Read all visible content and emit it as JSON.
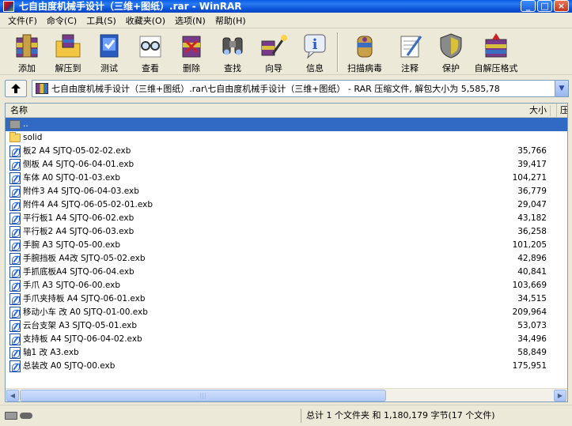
{
  "window": {
    "title": "七自由度机械手设计（三维+图纸）.rar - WinRAR"
  },
  "menu": [
    "文件(F)",
    "命令(C)",
    "工具(S)",
    "收藏夹(O)",
    "选项(N)",
    "帮助(H)"
  ],
  "toolbar": {
    "add": "添加",
    "extract": "解压到",
    "test": "测试",
    "view": "查看",
    "delete": "删除",
    "find": "查找",
    "wizard": "向导",
    "info": "信息",
    "virus": "扫描病毒",
    "comment": "注释",
    "protect": "保护",
    "sfx": "自解压格式"
  },
  "address": {
    "path": "七自由度机械手设计（三维+图纸）.rar\\七自由度机械手设计（三维+图纸） - RAR 压缩文件, 解包大小为 5,585,78"
  },
  "columns": {
    "name": "名称",
    "size": "大小",
    "packed": "压"
  },
  "files": [
    {
      "name": "..",
      "size": "",
      "type": "up",
      "selected": true
    },
    {
      "name": "solid",
      "size": "",
      "type": "folder"
    },
    {
      "name": "板2 A4 SJTQ-05-02-02.exb",
      "size": "35,766",
      "type": "exb"
    },
    {
      "name": "侧板 A4 SJTQ-06-04-01.exb",
      "size": "39,417",
      "type": "exb"
    },
    {
      "name": "车体 A0 SJTQ-01-03.exb",
      "size": "104,271",
      "type": "exb"
    },
    {
      "name": "附件3 A4 SJTQ-06-04-03.exb",
      "size": "36,779",
      "type": "exb"
    },
    {
      "name": "附件4 A4 SJTQ-06-05-02-01.exb",
      "size": "29,047",
      "type": "exb"
    },
    {
      "name": "平行板1 A4 SJTQ-06-02.exb",
      "size": "43,182",
      "type": "exb"
    },
    {
      "name": "平行板2 A4 SJTQ-06-03.exb",
      "size": "36,258",
      "type": "exb"
    },
    {
      "name": "手腕 A3 SJTQ-05-00.exb",
      "size": "101,205",
      "type": "exb"
    },
    {
      "name": "手腕挡板 A4改 SJTQ-05-02.exb",
      "size": "42,896",
      "type": "exb"
    },
    {
      "name": "手抓底板A4 SJTQ-06-04.exb",
      "size": "40,841",
      "type": "exb"
    },
    {
      "name": "手爪 A3 SJTQ-06-00.exb",
      "size": "103,669",
      "type": "exb"
    },
    {
      "name": "手爪夹持板 A4 SJTQ-06-01.exb",
      "size": "34,515",
      "type": "exb"
    },
    {
      "name": "移动小车 改 A0 SJTQ-01-00.exb",
      "size": "209,964",
      "type": "exb"
    },
    {
      "name": "云台支架 A3 SJTQ-05-01.exb",
      "size": "53,073",
      "type": "exb"
    },
    {
      "name": "支持板 A4 SJTQ-06-04-02.exb",
      "size": "34,496",
      "type": "exb"
    },
    {
      "name": "轴1 改 A3.exb",
      "size": "58,849",
      "type": "exb"
    },
    {
      "name": "总装改 A0 SJTQ-00.exb",
      "size": "175,951",
      "type": "exb"
    }
  ],
  "status": {
    "summary": "总计 1 个文件夹 和 1,180,179 字节(17 个文件)"
  }
}
